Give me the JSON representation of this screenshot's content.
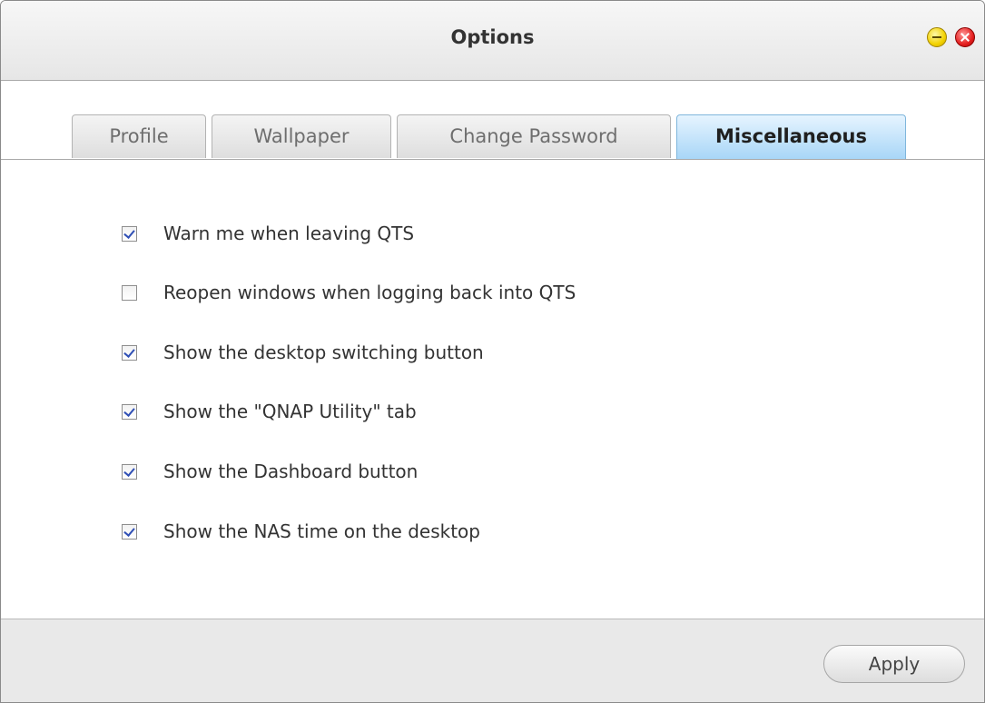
{
  "window": {
    "title": "Options"
  },
  "tabs": [
    {
      "label": "Profile",
      "active": false
    },
    {
      "label": "Wallpaper",
      "active": false
    },
    {
      "label": "Change Password",
      "active": false
    },
    {
      "label": "Miscellaneous",
      "active": true
    }
  ],
  "options": [
    {
      "label": "Warn me when leaving QTS",
      "checked": true
    },
    {
      "label": "Reopen windows when logging back into QTS",
      "checked": false
    },
    {
      "label": "Show the desktop switching button",
      "checked": true
    },
    {
      "label": "Show the \"QNAP Utility\" tab",
      "checked": true
    },
    {
      "label": "Show the Dashboard button",
      "checked": true
    },
    {
      "label": "Show the NAS time on the desktop",
      "checked": true
    }
  ],
  "footer": {
    "apply_label": "Apply"
  },
  "colors": {
    "active_tab": "#a8d6f7",
    "checkmark": "#2f4fb5",
    "minimize": "#f2d200",
    "close": "#e52020"
  }
}
